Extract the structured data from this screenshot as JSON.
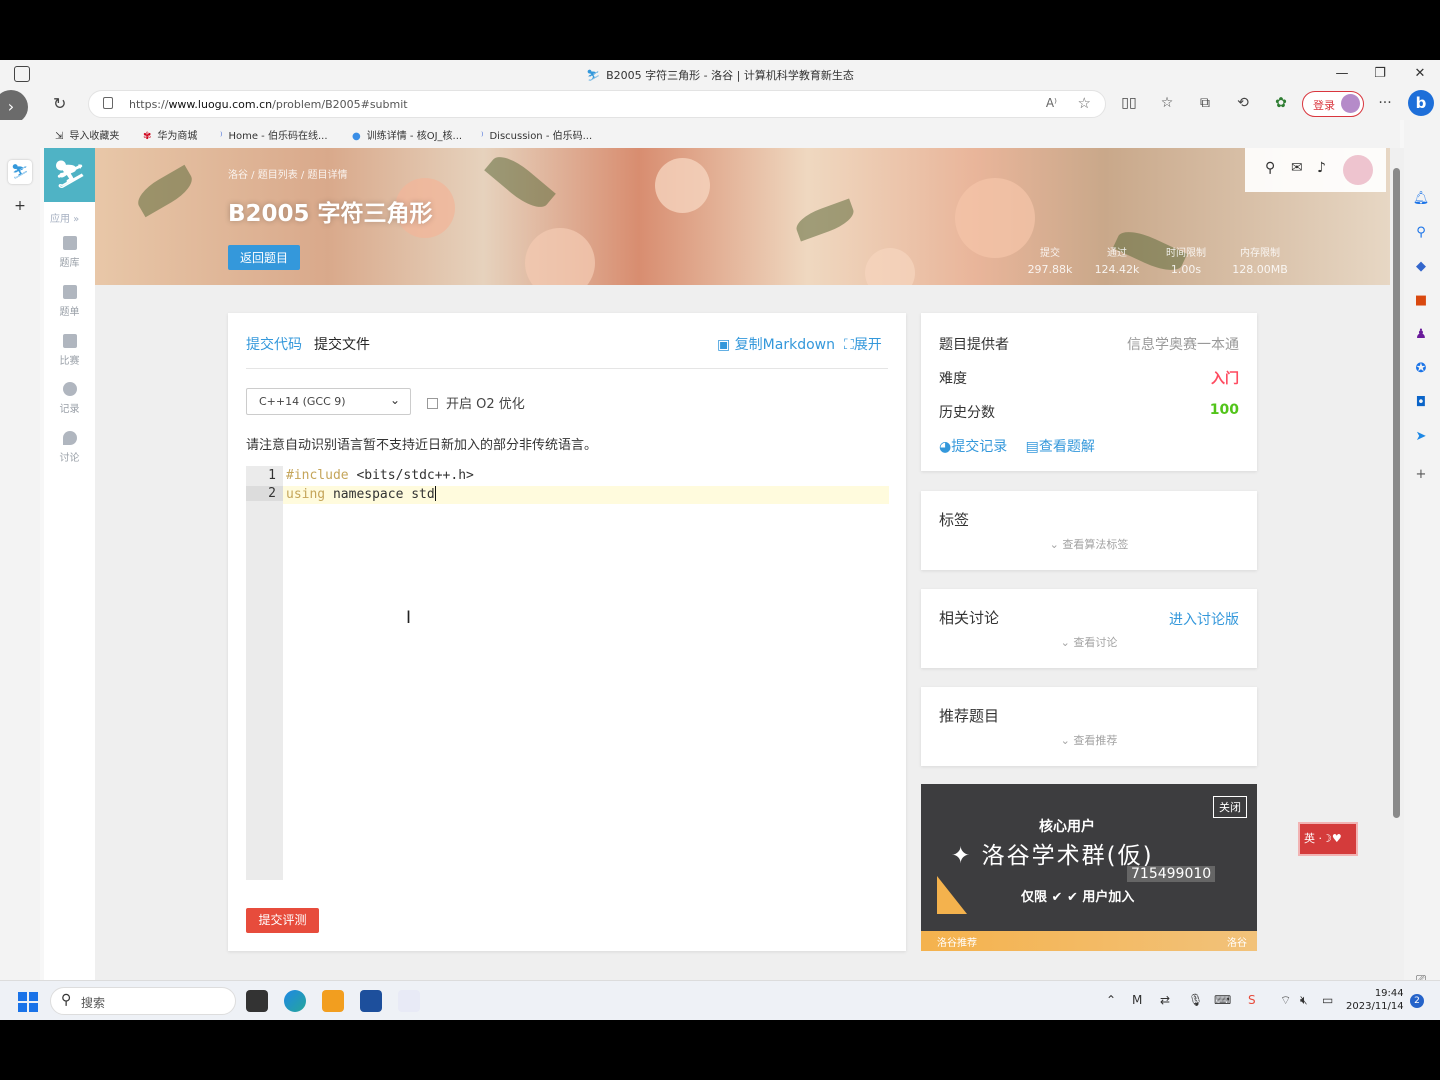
{
  "browser": {
    "window_title": "B2005 字符三角形 - 洛谷 | 计算机科学教育新生态",
    "url_prefix": "https://",
    "url_host": "www.luogu.com.cn",
    "url_path": "/problem/B2005#submit",
    "login_label": "登录",
    "bookmarks": [
      {
        "label": "导入收藏夹",
        "icon": "import-icon"
      },
      {
        "label": "华为商城",
        "icon": "huawei-icon"
      },
      {
        "label": "Home - 伯乐码在线...",
        "icon": "bolema-icon"
      },
      {
        "label": "训练详情 - 核OJ_核...",
        "icon": "drop-icon"
      },
      {
        "label": "Discussion - 伯乐码...",
        "icon": "bolema-icon"
      }
    ]
  },
  "nav": {
    "apps_label": "应用 »",
    "items": [
      {
        "label": "题库",
        "icon": "book-icon"
      },
      {
        "label": "题单",
        "icon": "list-icon"
      },
      {
        "label": "比赛",
        "icon": "bar-chart-icon"
      },
      {
        "label": "记录",
        "icon": "pie-icon"
      },
      {
        "label": "讨论",
        "icon": "chat-icon"
      }
    ]
  },
  "banner": {
    "breadcrumb": "洛谷 / 题目列表 / 题目详情",
    "title": "B2005 字符三角形",
    "back_label": "返回题目",
    "stats": [
      {
        "label": "提交",
        "value": "297.88k"
      },
      {
        "label": "通过",
        "value": "124.42k"
      },
      {
        "label": "时间限制",
        "value": "1.00s"
      },
      {
        "label": "内存限制",
        "value": "128.00MB"
      }
    ]
  },
  "submit": {
    "tab_code": "提交代码",
    "tab_file": "提交文件",
    "copy_markdown": "复制Markdown",
    "expand": "展开",
    "language": "C++14 (GCC 9)",
    "o2_label": "开启 O2 优化",
    "notice": "请注意自动识别语言暂不支持近日新加入的部分非传统语言。",
    "code_lines": [
      {
        "num": "1",
        "pre": "#include",
        "rest": " <bits/stdc++.h>"
      },
      {
        "num": "2",
        "pre": "using",
        "rest": " namespace std"
      }
    ],
    "submit_label": "提交评测"
  },
  "info": {
    "provider_label": "题目提供者",
    "provider_value": "信息学奥赛一本通",
    "difficulty_label": "难度",
    "difficulty_value": "入门",
    "history_label": "历史分数",
    "history_value": "100",
    "records_link": "提交记录",
    "solution_link": "查看题解",
    "difficulty_color": "#fe4c61",
    "history_color": "#52c41a"
  },
  "tags": {
    "title": "标签",
    "more": "查看算法标签"
  },
  "discuss": {
    "title": "相关讨论",
    "link": "进入讨论版",
    "more": "查看讨论"
  },
  "recommend": {
    "title": "推荐题目",
    "more": "查看推荐"
  },
  "ad": {
    "close": "关闭",
    "line1": "核心用户",
    "line2": "洛谷学术群(仮)",
    "qq": "715499010",
    "line3": "仅限 ✔ ✔ 用户加入",
    "footer_left": "洛谷推荐",
    "footer_right": "洛谷"
  },
  "ime": "英 ·☽♥",
  "taskbar": {
    "search_label": "搜索",
    "time": "19:44",
    "date": "2023/11/14",
    "notifications": "2"
  }
}
